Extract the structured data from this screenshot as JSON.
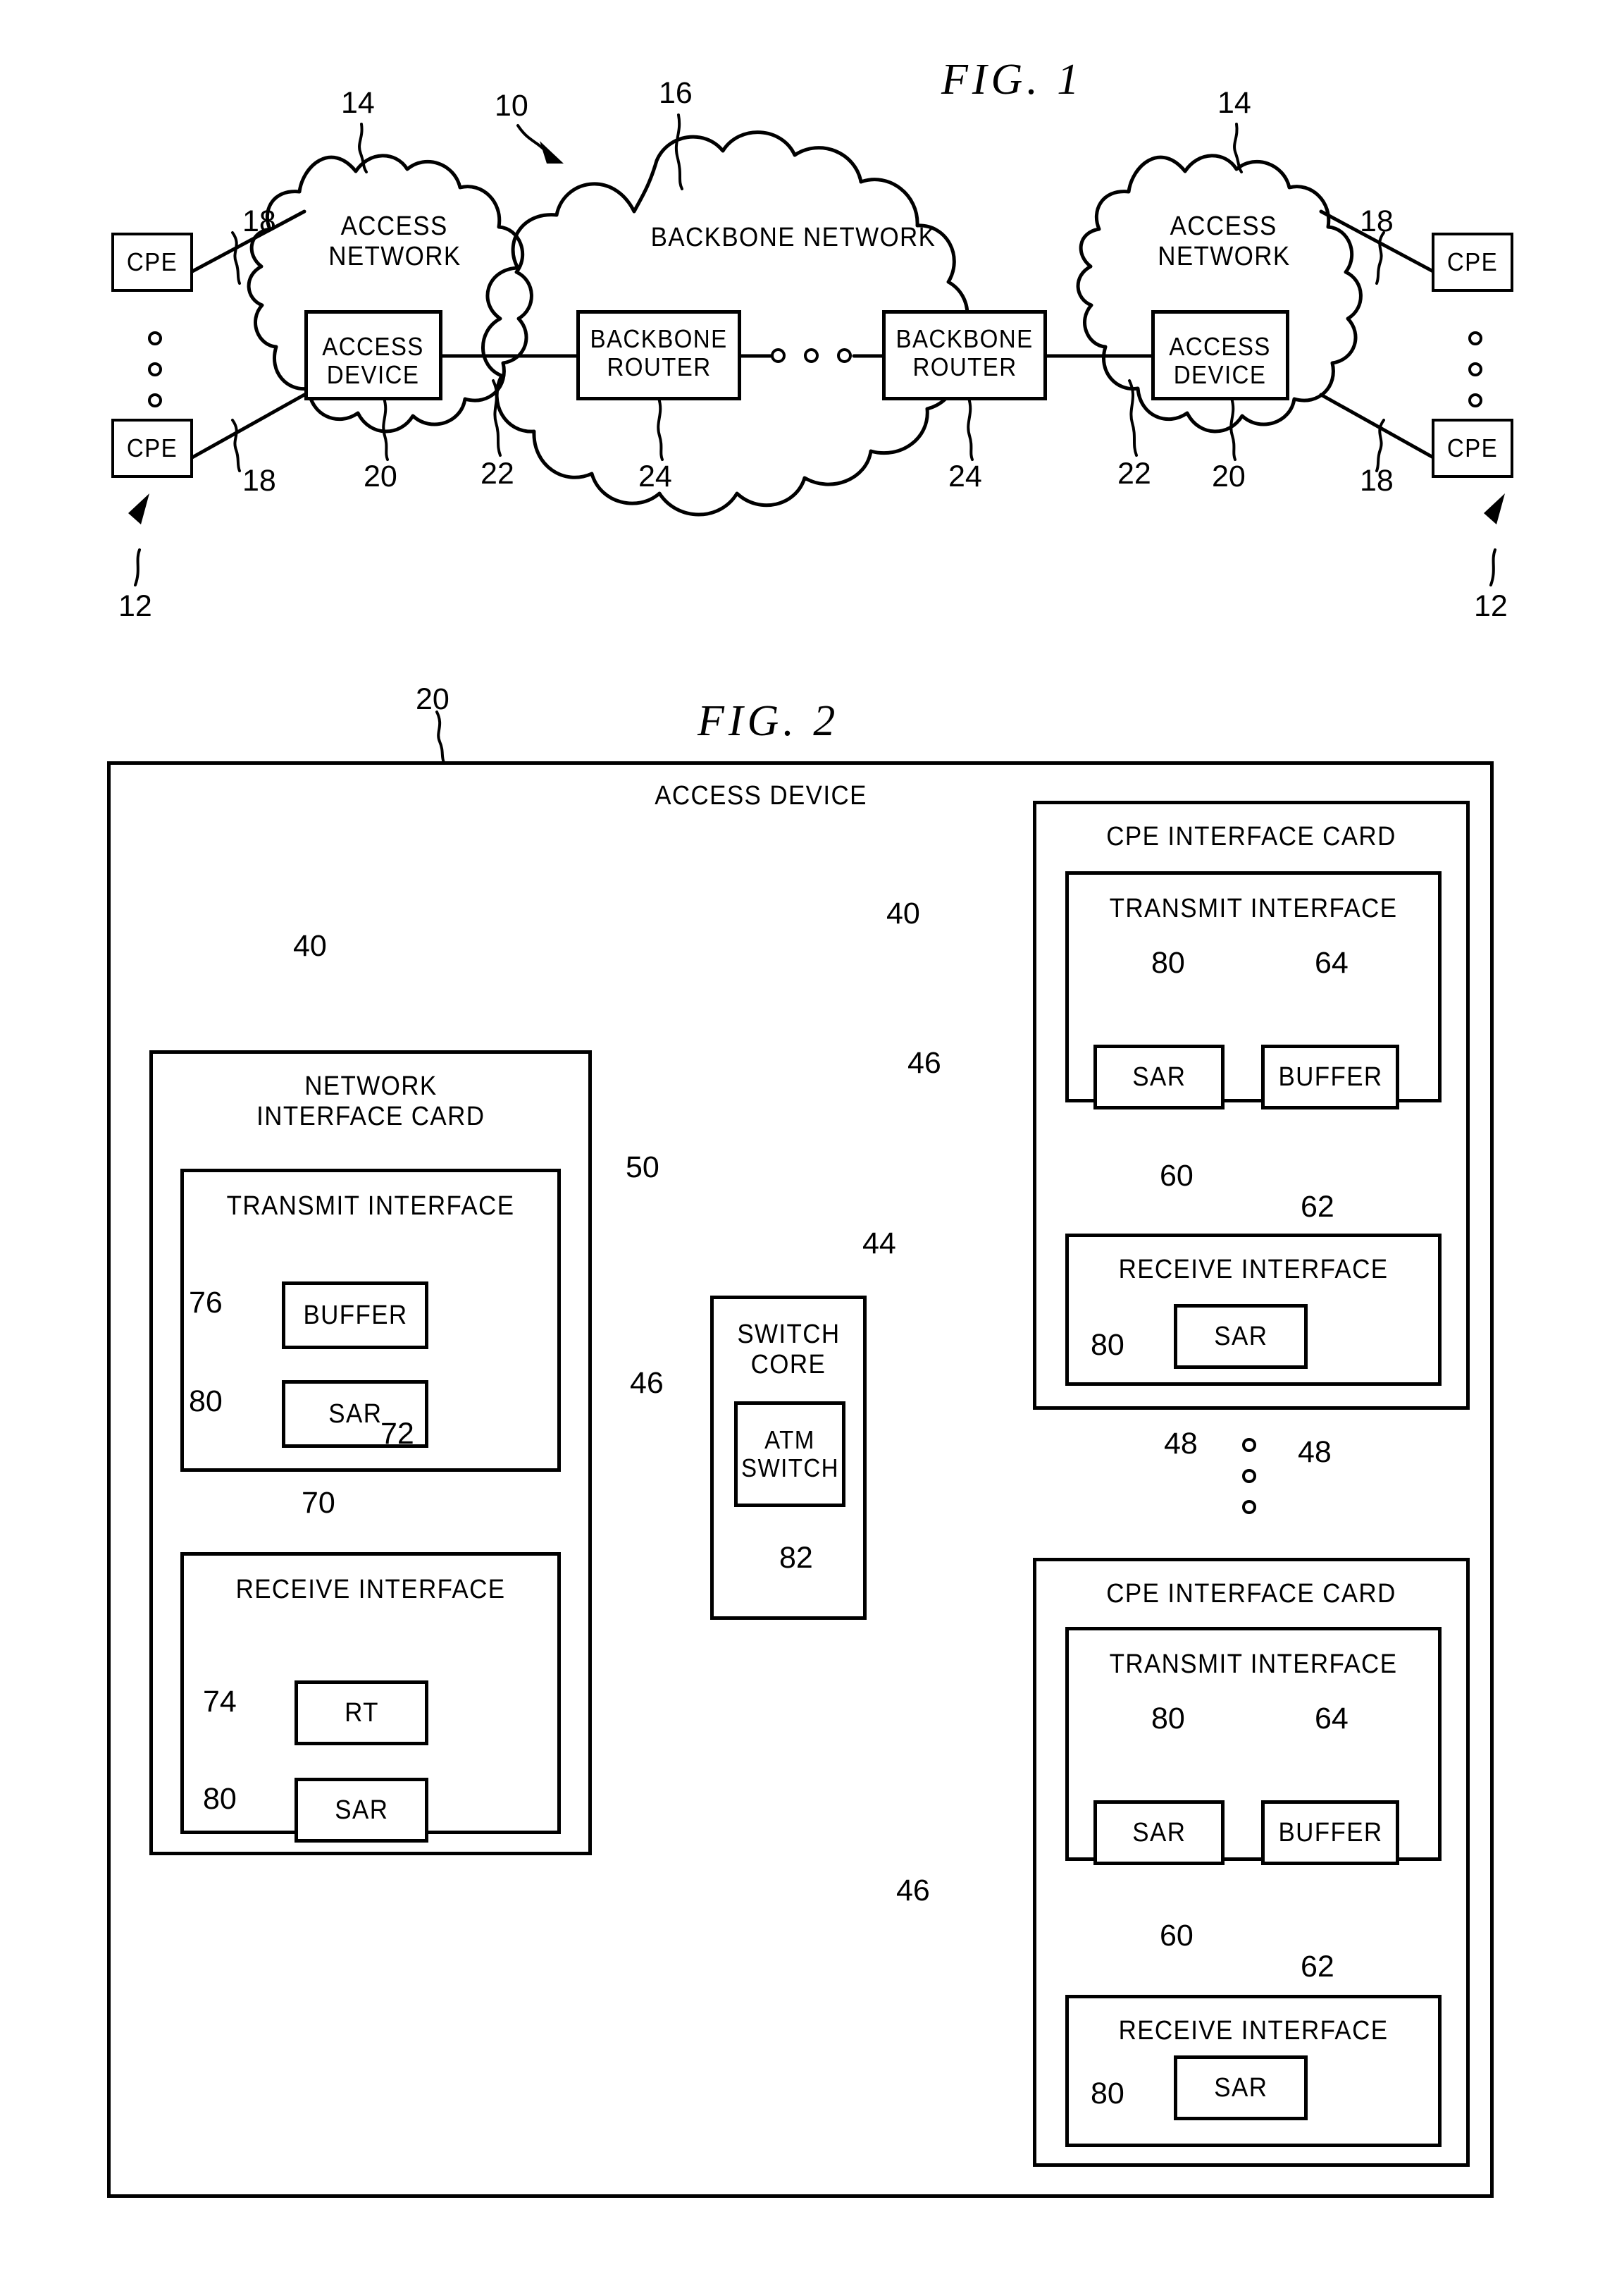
{
  "figures": [
    {
      "title": "FIG.  1",
      "nodes": {
        "cpe": "CPE",
        "access_network": "ACCESS\nNETWORK",
        "access_network_l1": "ACCESS",
        "access_network_l2": "NETWORK",
        "backbone_network": "BACKBONE  NETWORK",
        "access_device_l1": "ACCESS",
        "access_device_l2": "DEVICE",
        "backbone_router_l1": "BACKBONE",
        "backbone_router_l2": "ROUTER"
      },
      "refs": {
        "system": "10",
        "cpe": "12",
        "access_network": "14",
        "backbone_network": "16",
        "cpe_link": "18",
        "access_device": "20",
        "network_link": "22",
        "backbone_router": "24"
      }
    },
    {
      "title": "FIG.  2",
      "nodes": {
        "access_device": "ACCESS DEVICE",
        "network_interface_card_l1": "NETWORK",
        "network_interface_card_l2": "INTERFACE CARD",
        "cpe_interface_card": "CPE  INTERFACE  CARD",
        "transmit_interface": "TRANSMIT  INTERFACE",
        "receive_interface": "RECEIVE  INTERFACE",
        "buffer": "BUFFER",
        "sar": "SAR",
        "rt": "RT",
        "switch_core_l1": "SWITCH",
        "switch_core_l2": "CORE",
        "atm_switch_l1": "ATM",
        "atm_switch_l2": "SWITCH"
      },
      "refs": {
        "access_device": "20",
        "interface_card": "40",
        "switch_core": "44",
        "switch_link": "46",
        "cpe_card_slot": "48",
        "nic": "50",
        "cpe_transmit_interface": "60",
        "cpe_transmit_ref": "62",
        "cpe_buffer": "64",
        "nic_transmit_interface": "70",
        "nic_transmit_ref": "72",
        "nic_rt": "74",
        "nic_buffer": "76",
        "sar": "80",
        "atm_switch": "82"
      }
    }
  ],
  "fig1": {
    "left_cpe_top": "CPE",
    "left_cpe_bottom": "CPE",
    "right_cpe_top": "CPE",
    "right_cpe_bottom": "CPE",
    "left_access_network_l1": "ACCESS",
    "left_access_network_l2": "NETWORK",
    "right_access_network_l1": "ACCESS",
    "right_access_network_l2": "NETWORK",
    "backbone_network": "BACKBONE  NETWORK",
    "left_access_device_l1": "ACCESS",
    "left_access_device_l2": "DEVICE",
    "right_access_device_l1": "ACCESS",
    "right_access_device_l2": "DEVICE",
    "left_router_l1": "BACKBONE",
    "left_router_l2": "ROUTER",
    "right_router_l1": "BACKBONE",
    "right_router_l2": "ROUTER",
    "title": "FIG.  1",
    "ref_14_left": "14",
    "ref_14_right": "14",
    "ref_10": "10",
    "ref_16": "16",
    "ref_18_lt": "18",
    "ref_18_lb": "18",
    "ref_18_rt": "18",
    "ref_18_rb": "18",
    "ref_20_left": "20",
    "ref_20_right": "20",
    "ref_22_left": "22",
    "ref_22_right": "22",
    "ref_24_left": "24",
    "ref_24_right": "24",
    "ref_12_left": "12",
    "ref_12_right": "12"
  },
  "fig2": {
    "title": "FIG.  2",
    "ref_20": "20",
    "access_device": "ACCESS DEVICE",
    "nic": {
      "ref_40": "40",
      "title_l1": "NETWORK",
      "title_l2": "INTERFACE CARD",
      "ref_50": "50",
      "transmit": {
        "title": "TRANSMIT  INTERFACE",
        "ref_76": "76",
        "buffer": "BUFFER",
        "ref_80": "80",
        "sar": "SAR",
        "ref_70": "70",
        "ref_72": "72"
      },
      "receive": {
        "title": "RECEIVE  INTERFACE",
        "ref_74": "74",
        "rt": "RT",
        "ref_80": "80",
        "sar": "SAR"
      }
    },
    "switch": {
      "ref_44": "44",
      "title_l1": "SWITCH",
      "title_l2": "CORE",
      "atm_l1": "ATM",
      "atm_l2": "SWITCH",
      "ref_82": "82",
      "ref_46_left": "46",
      "ref_46_top": "46",
      "ref_46_bottom": "46"
    },
    "cpe_card_top": {
      "ref_40": "40",
      "title": "CPE  INTERFACE  CARD",
      "transmit_title": "TRANSMIT  INTERFACE",
      "ref_80": "80",
      "ref_64": "64",
      "sar": "SAR",
      "buffer": "BUFFER",
      "ref_60": "60",
      "ref_62": "62",
      "receive_title": "RECEIVE  INTERFACE",
      "ref_80b": "80",
      "sar_rx": "SAR"
    },
    "cpe_card_bottom": {
      "title": "CPE  INTERFACE  CARD",
      "transmit_title": "TRANSMIT  INTERFACE",
      "ref_80": "80",
      "ref_64": "64",
      "sar": "SAR",
      "buffer": "BUFFER",
      "ref_60": "60",
      "ref_62": "62",
      "receive_title": "RECEIVE  INTERFACE",
      "ref_80b": "80",
      "sar_rx": "SAR"
    },
    "ref_48_left": "48",
    "ref_48_right": "48"
  },
  "colors": {
    "ink": "#000000",
    "paper": "#ffffff"
  }
}
